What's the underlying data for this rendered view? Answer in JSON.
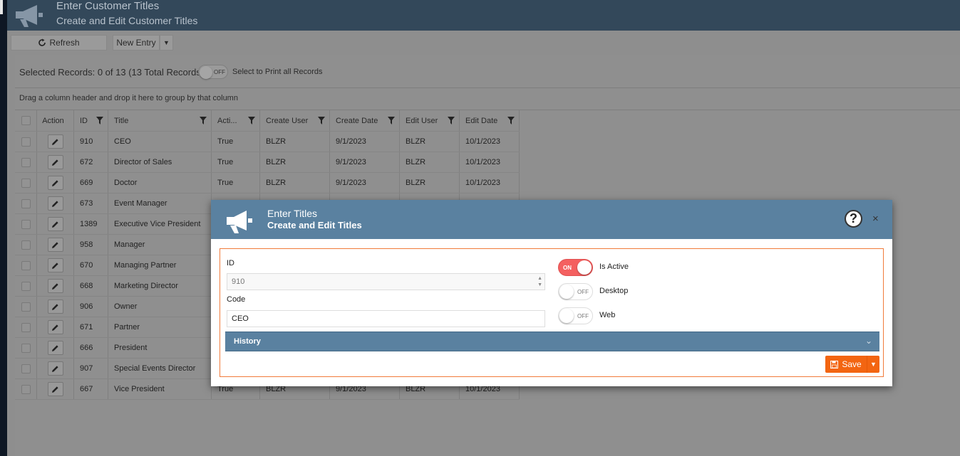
{
  "header": {
    "title": "Enter Customer Titles",
    "subtitle": "Create and Edit Customer Titles",
    "icon": "megaphone-icon"
  },
  "toolbar": {
    "refresh_label": "Refresh",
    "new_entry_label": "New Entry",
    "dropdown_glyph": "▼"
  },
  "selection": {
    "text": "Selected Records: 0 of 13 (13 Total Records)",
    "toggle_label": "OFF",
    "print_label": "Select to Print all Records"
  },
  "group_hint": "Drag a column header and drop it here to group by that column",
  "grid": {
    "columns": [
      "Action",
      "ID",
      "Title",
      "Acti...",
      "Create User",
      "Create Date",
      "Edit User",
      "Edit Date"
    ],
    "rows": [
      {
        "id": "910",
        "title": "CEO",
        "active": "True",
        "create_user": "BLZR",
        "create_date": "9/1/2023",
        "edit_user": "BLZR",
        "edit_date": "10/1/2023"
      },
      {
        "id": "672",
        "title": "Director of Sales",
        "active": "True",
        "create_user": "BLZR",
        "create_date": "9/1/2023",
        "edit_user": "BLZR",
        "edit_date": "10/1/2023"
      },
      {
        "id": "669",
        "title": "Doctor",
        "active": "True",
        "create_user": "BLZR",
        "create_date": "9/1/2023",
        "edit_user": "BLZR",
        "edit_date": "10/1/2023"
      },
      {
        "id": "673",
        "title": "Event Manager",
        "active": "",
        "create_user": "",
        "create_date": "",
        "edit_user": "",
        "edit_date": ""
      },
      {
        "id": "1389",
        "title": "Executive Vice President",
        "active": "",
        "create_user": "",
        "create_date": "",
        "edit_user": "",
        "edit_date": ""
      },
      {
        "id": "958",
        "title": "Manager",
        "active": "",
        "create_user": "",
        "create_date": "",
        "edit_user": "",
        "edit_date": ""
      },
      {
        "id": "670",
        "title": "Managing Partner",
        "active": "",
        "create_user": "",
        "create_date": "",
        "edit_user": "",
        "edit_date": ""
      },
      {
        "id": "668",
        "title": "Marketing Director",
        "active": "",
        "create_user": "",
        "create_date": "",
        "edit_user": "",
        "edit_date": ""
      },
      {
        "id": "906",
        "title": "Owner",
        "active": "",
        "create_user": "",
        "create_date": "",
        "edit_user": "",
        "edit_date": ""
      },
      {
        "id": "671",
        "title": "Partner",
        "active": "",
        "create_user": "",
        "create_date": "",
        "edit_user": "",
        "edit_date": ""
      },
      {
        "id": "666",
        "title": "President",
        "active": "",
        "create_user": "",
        "create_date": "",
        "edit_user": "",
        "edit_date": ""
      },
      {
        "id": "907",
        "title": "Special Events Director",
        "active": "",
        "create_user": "",
        "create_date": "",
        "edit_user": "",
        "edit_date": ""
      },
      {
        "id": "667",
        "title": "Vice President",
        "active": "True",
        "create_user": "BLZR",
        "create_date": "9/1/2023",
        "edit_user": "BLZR",
        "edit_date": "10/1/2023"
      }
    ]
  },
  "modal": {
    "title": "Enter Titles",
    "subtitle": "Create and Edit Titles",
    "help_glyph": "?",
    "close_glyph": "×",
    "id_label": "ID",
    "id_value": "910",
    "code_label": "Code",
    "code_value": "CEO",
    "is_active_label": "Is Active",
    "is_active_state": "ON",
    "desktop_label": "Desktop",
    "desktop_state": "OFF",
    "web_label": "Web",
    "web_state": "OFF",
    "history_label": "History",
    "save_label": "Save"
  },
  "colors": {
    "header_bg": "#33485a",
    "modal_header_bg": "#5a81a0",
    "accent_orange": "#f36511",
    "toggle_on": "#f46060"
  }
}
